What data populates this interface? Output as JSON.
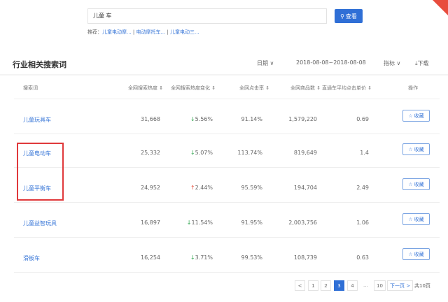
{
  "search": {
    "value": "儿童 车",
    "button": "查看",
    "suggest_label": "推荐：",
    "suggestions": [
      "儿童电动摩...",
      "电动摩托车...",
      "儿童电动三..."
    ]
  },
  "section": {
    "title": "行业相关搜索词",
    "date_label": "日期",
    "date_range": "2018-08-08~2018-08-08",
    "metric_label": "指标",
    "download": "下载"
  },
  "table": {
    "headers": [
      "搜索词",
      "全网搜索热度",
      "全网搜索热度变化",
      "全网点击率",
      "全网商品数",
      "直通车平均点击单价",
      "操作"
    ],
    "rows": [
      {
        "keyword": "儿童玩具车",
        "heat": "31,668",
        "change": "5.56%",
        "dir": "down",
        "ctr": "91.14%",
        "items": "1,579,220",
        "cpc": "0.69",
        "action": "收藏"
      },
      {
        "keyword": "儿童电动车",
        "heat": "25,332",
        "change": "5.07%",
        "dir": "down",
        "ctr": "113.74%",
        "items": "819,649",
        "cpc": "1.4",
        "action": "收藏"
      },
      {
        "keyword": "儿童平衡车",
        "heat": "24,952",
        "change": "2.44%",
        "dir": "up",
        "ctr": "95.59%",
        "items": "194,704",
        "cpc": "2.49",
        "action": "收藏"
      },
      {
        "keyword": "儿童益智玩具",
        "heat": "16,897",
        "change": "11.54%",
        "dir": "down",
        "ctr": "91.95%",
        "items": "2,003,756",
        "cpc": "1.06",
        "action": "收藏"
      },
      {
        "keyword": "滑板车",
        "heat": "16,254",
        "change": "3.71%",
        "dir": "down",
        "ctr": "99.53%",
        "items": "108,739",
        "cpc": "0.63",
        "action": "收藏"
      }
    ]
  },
  "pagination": {
    "prev": "<",
    "pages": [
      "1",
      "2",
      "3",
      "4"
    ],
    "ellipsis": "...",
    "last": "10",
    "current": "3",
    "next": "下一页 >",
    "total": "共10页"
  }
}
